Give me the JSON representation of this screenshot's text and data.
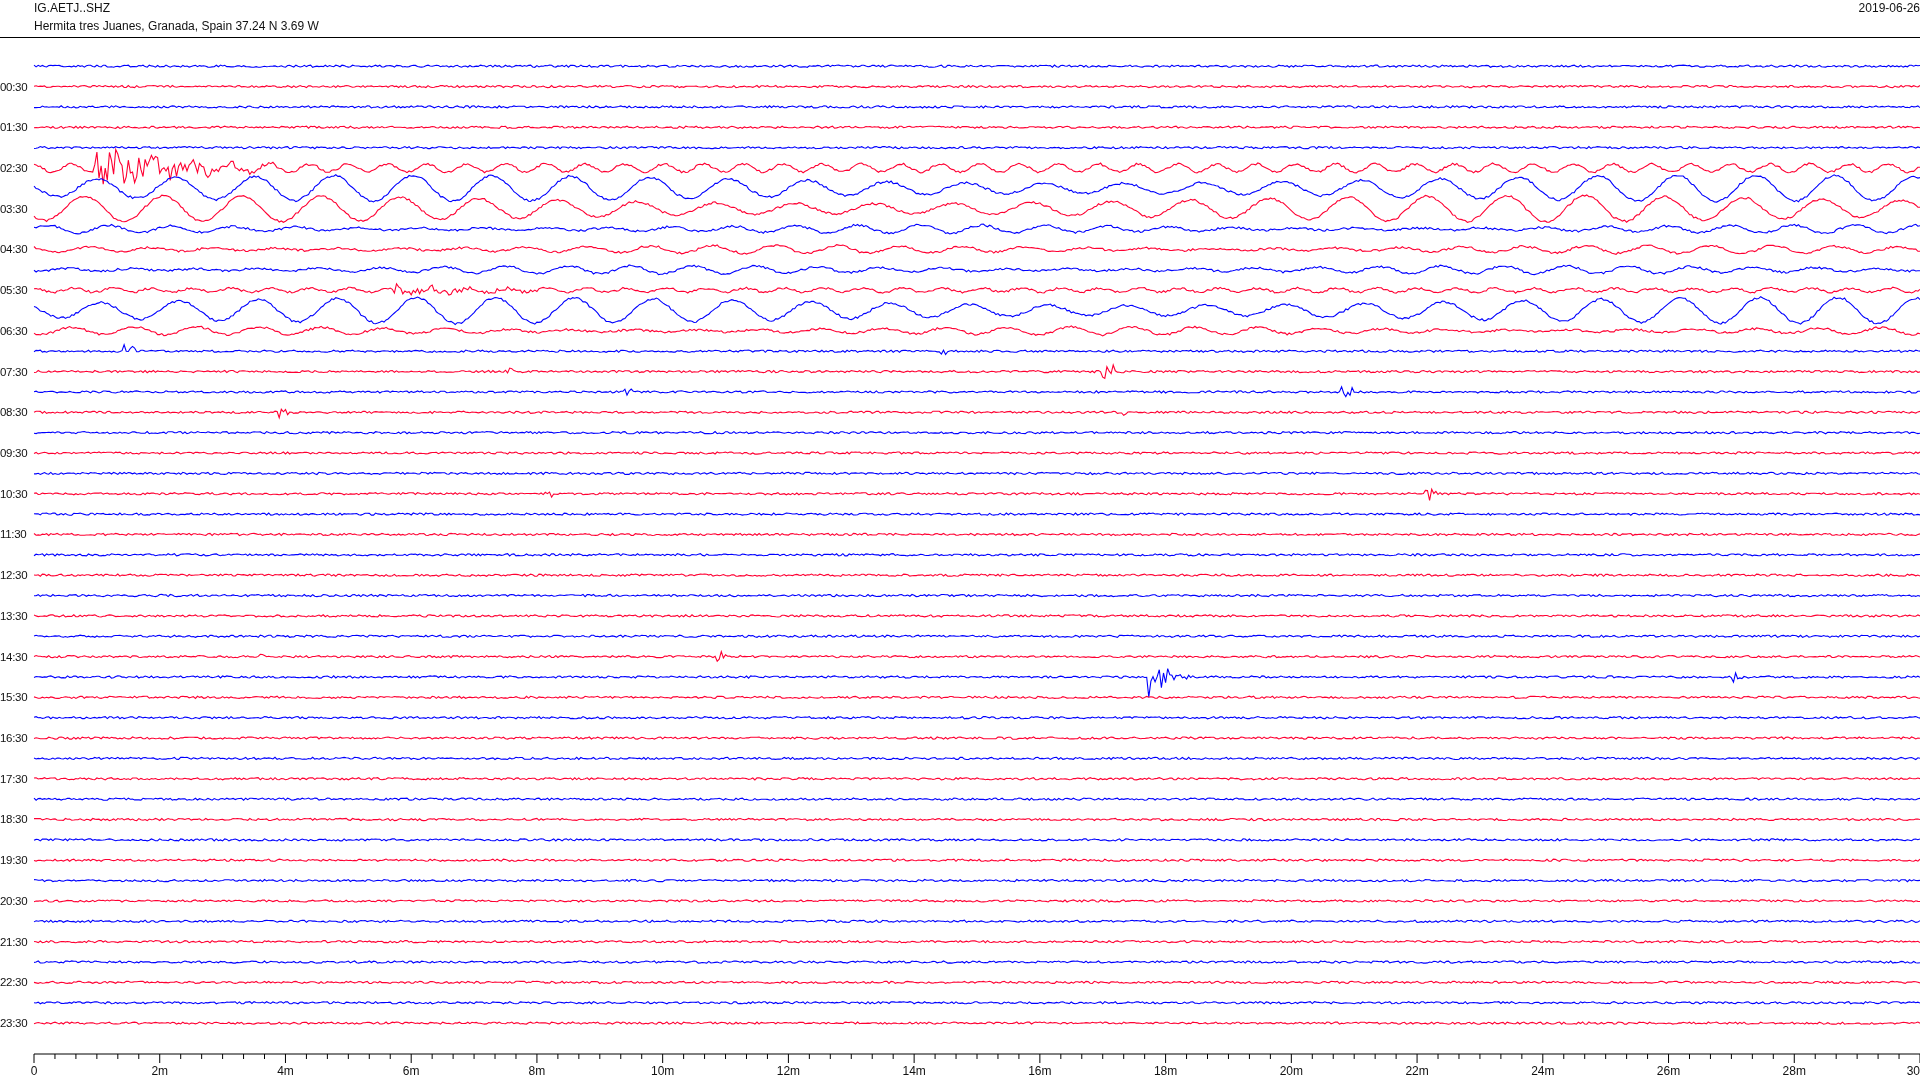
{
  "header": {
    "station": "IG.AETJ..SHZ",
    "location": "Hermita tres Juanes, Granada, Spain  37.24 N 3.69 W",
    "date": "2019-06-26"
  },
  "traces": [
    {
      "color": "#0000ff",
      "kind": "quiet"
    },
    {
      "label": "00:30",
      "color": "#ff0033",
      "kind": "quiet"
    },
    {
      "color": "#0000ff",
      "kind": "quiet"
    },
    {
      "label": "01:30",
      "color": "#ff0033",
      "kind": "quiet"
    },
    {
      "color": "#0000ff",
      "kind": "quiet"
    },
    {
      "label": "02:30",
      "color": "#ff0033",
      "kind": "burst"
    },
    {
      "color": "#0000ff",
      "kind": "swell"
    },
    {
      "label": "03:30",
      "color": "#ff0033",
      "kind": "swell"
    },
    {
      "color": "#0000ff",
      "kind": "ripple"
    },
    {
      "label": "04:30",
      "color": "#ff0033",
      "kind": "ripple"
    },
    {
      "color": "#0000ff",
      "kind": "ripple"
    },
    {
      "label": "05:30",
      "color": "#ff0033",
      "kind": "burst"
    },
    {
      "color": "#0000ff",
      "kind": "swell"
    },
    {
      "label": "06:30",
      "color": "#ff0033",
      "kind": "ripple"
    },
    {
      "color": "#0000ff",
      "kind": "spike"
    },
    {
      "label": "07:30",
      "color": "#ff0033",
      "kind": "spike"
    },
    {
      "color": "#0000ff",
      "kind": "spike"
    },
    {
      "label": "08:30",
      "color": "#ff0033",
      "kind": "spike"
    },
    {
      "color": "#0000ff",
      "kind": "quiet"
    },
    {
      "label": "09:30",
      "color": "#ff0033",
      "kind": "quiet"
    },
    {
      "color": "#0000ff",
      "kind": "quiet"
    },
    {
      "label": "10:30",
      "color": "#ff0033",
      "kind": "spike"
    },
    {
      "color": "#0000ff",
      "kind": "quiet"
    },
    {
      "label": "11:30",
      "color": "#ff0033",
      "kind": "quiet"
    },
    {
      "color": "#0000ff",
      "kind": "quiet"
    },
    {
      "label": "12:30",
      "color": "#ff0033",
      "kind": "quiet"
    },
    {
      "color": "#0000ff",
      "kind": "quiet"
    },
    {
      "label": "13:30",
      "color": "#ff0033",
      "kind": "quiet"
    },
    {
      "color": "#0000ff",
      "kind": "quiet"
    },
    {
      "label": "14:30",
      "color": "#ff0033",
      "kind": "spike"
    },
    {
      "color": "#0000ff",
      "kind": "quake"
    },
    {
      "label": "15:30",
      "color": "#ff0033",
      "kind": "quiet"
    },
    {
      "color": "#0000ff",
      "kind": "quiet"
    },
    {
      "label": "16:30",
      "color": "#ff0033",
      "kind": "quiet"
    },
    {
      "color": "#0000ff",
      "kind": "quiet"
    },
    {
      "label": "17:30",
      "color": "#ff0033",
      "kind": "quiet"
    },
    {
      "color": "#0000ff",
      "kind": "quiet"
    },
    {
      "label": "18:30",
      "color": "#ff0033",
      "kind": "quiet"
    },
    {
      "color": "#0000ff",
      "kind": "quiet"
    },
    {
      "label": "19:30",
      "color": "#ff0033",
      "kind": "quiet"
    },
    {
      "color": "#0000ff",
      "kind": "quiet"
    },
    {
      "label": "20:30",
      "color": "#ff0033",
      "kind": "quiet"
    },
    {
      "color": "#0000ff",
      "kind": "quiet"
    },
    {
      "label": "21:30",
      "color": "#ff0033",
      "kind": "quiet"
    },
    {
      "color": "#0000ff",
      "kind": "quiet"
    },
    {
      "label": "22:30",
      "color": "#ff0033",
      "kind": "quiet"
    },
    {
      "color": "#0000ff",
      "kind": "quiet"
    },
    {
      "label": "23:30",
      "color": "#ff0033",
      "kind": "quiet"
    }
  ],
  "axis": {
    "tick_labels": [
      "0",
      "2m",
      "4m",
      "6m",
      "8m",
      "10m",
      "12m",
      "14m",
      "16m",
      "18m",
      "20m",
      "22m",
      "24m",
      "26m",
      "28m",
      "30"
    ]
  }
}
